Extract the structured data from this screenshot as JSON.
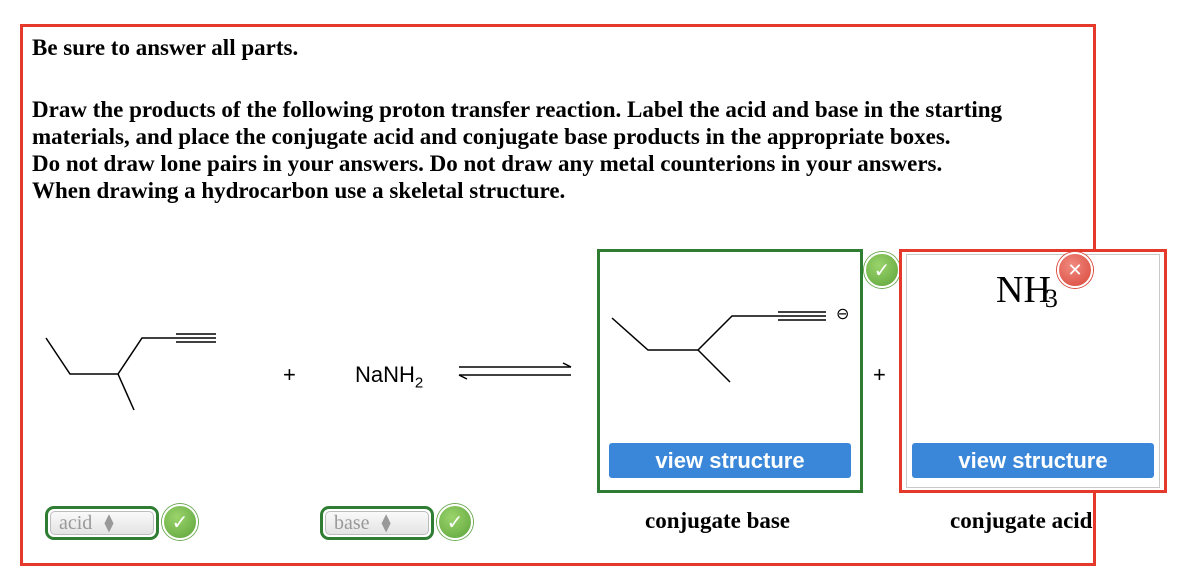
{
  "question": {
    "title": "Be sure to answer all parts.",
    "instructions": [
      "Draw the products of the following proton transfer reaction. Label the acid and base in the starting",
      "materials, and place the conjugate acid and conjugate base products in the appropriate boxes.",
      "Do not draw lone pairs in your answers. Do not draw any metal counterions in your answers.",
      "When drawing a hydrocarbon use a skeletal structure."
    ]
  },
  "reaction": {
    "plus_sign": "+",
    "reagent_main": "NaNH",
    "reagent_sub": "2",
    "charge_symbol": "⊖",
    "arrow_icon": "equilibrium-arrows-icon"
  },
  "conjugate_base_box": {
    "view_button": "view structure",
    "caption": "conjugate base",
    "status_icon": "check-icon",
    "status_color": "#2e7d32"
  },
  "conjugate_acid_box": {
    "formula_main": "NH",
    "formula_sub": "3",
    "view_button": "view structure",
    "caption": "conjugate acid",
    "status_icon": "x-icon",
    "status_color": "#e4392b"
  },
  "labels": {
    "acid_select_value": "acid",
    "base_select_value": "base",
    "stepper_up": "▲",
    "stepper_down": "▼",
    "check_glyph": "✓",
    "x_glyph": "✕"
  }
}
